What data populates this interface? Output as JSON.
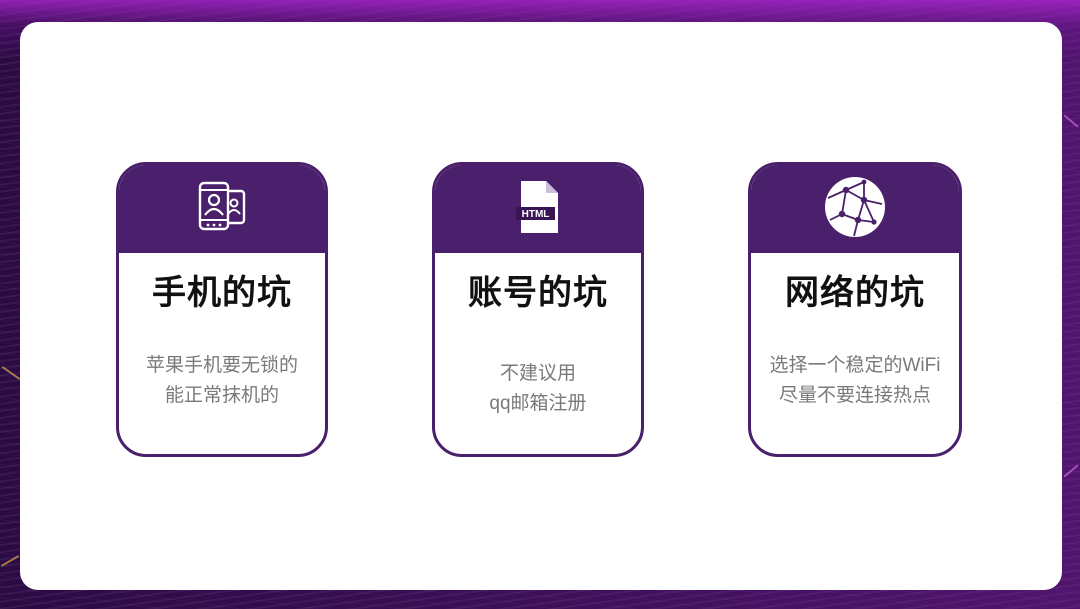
{
  "slide": {
    "colors": {
      "background": "#2b0a43",
      "accent_glow": "#b028d6",
      "panel": "#ffffff",
      "card_header": "#4a1f6b",
      "card_border": "#4a1f6b",
      "title": "#111111",
      "text": "#7a7a7a"
    },
    "cards": [
      {
        "icon": "phone-contact-icon",
        "title": "手机的坑",
        "lines": [
          "苹果手机要无锁的",
          "能正常抹机的"
        ]
      },
      {
        "icon": "html-file-icon",
        "icon_label": "HTML",
        "title": "账号的坑",
        "lines": [
          "不建议用",
          "qq邮箱注册"
        ]
      },
      {
        "icon": "globe-network-icon",
        "title": "网络的坑",
        "lines": [
          "选择一个稳定的WiFi",
          "尽量不要连接热点"
        ]
      }
    ]
  }
}
